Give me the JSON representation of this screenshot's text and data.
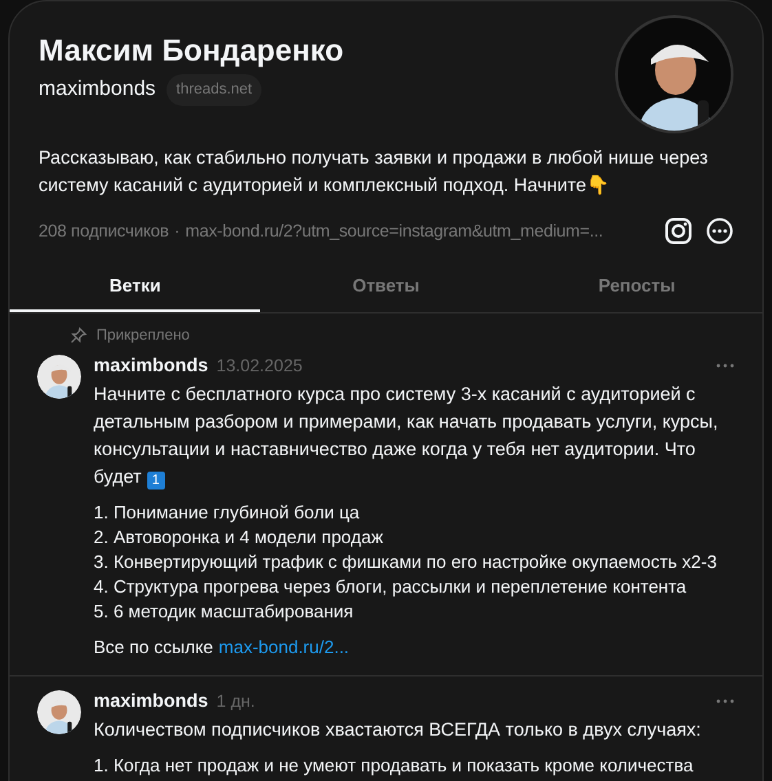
{
  "profile": {
    "name": "Максим Бондаренко",
    "username": "maximbonds",
    "domain_badge": "threads.net",
    "bio": "Рассказываю, как стабильно получать заявки и продажи в любой нише через систему касаний с аудиторией и комплексный подход. Начните👇",
    "followers": "208 подписчиков",
    "separator": "·",
    "link": "max-bond.ru/2?utm_source=instagram&utm_medium=..."
  },
  "tabs": [
    {
      "label": "Ветки",
      "selected": true
    },
    {
      "label": "Ответы",
      "selected": false
    },
    {
      "label": "Репосты",
      "selected": false
    }
  ],
  "posts": [
    {
      "pinned_label": "Прикреплено",
      "username": "maximbonds",
      "date": "13.02.2025",
      "blocks": [
        {
          "kind": "text",
          "text": "Начните с бесплатного курса про систему 3-х касаний с аудиторией с детальным разбором и примерами, как начать продавать услуги, курсы, консультации и наставничество даже когда у тебя нет аудитории. Что будет",
          "keycap": "1"
        },
        {
          "kind": "list",
          "items": [
            "1. Понимание глубиной боли ца",
            "2. Автоворонка и 4 модели продаж",
            "3. Конвертирующий трафик с фишками по его настройке окупаемость x2-3",
            "4. Структура прогрева через блоги, рассылки и переплетение контента",
            "5. 6 методик масштабирования"
          ]
        },
        {
          "kind": "link_line",
          "text": "Все по ссылке",
          "link": "max-bond.ru/2..."
        }
      ]
    },
    {
      "username": "maximbonds",
      "date": "1 дн.",
      "blocks": [
        {
          "kind": "text",
          "text": "Количеством подписчиков хвастаются ВСЕГДА только в двух случаях:"
        },
        {
          "kind": "list",
          "items": [
            "1. Когда нет продаж и не умеют продавать и показать кроме количества"
          ]
        }
      ]
    }
  ]
}
